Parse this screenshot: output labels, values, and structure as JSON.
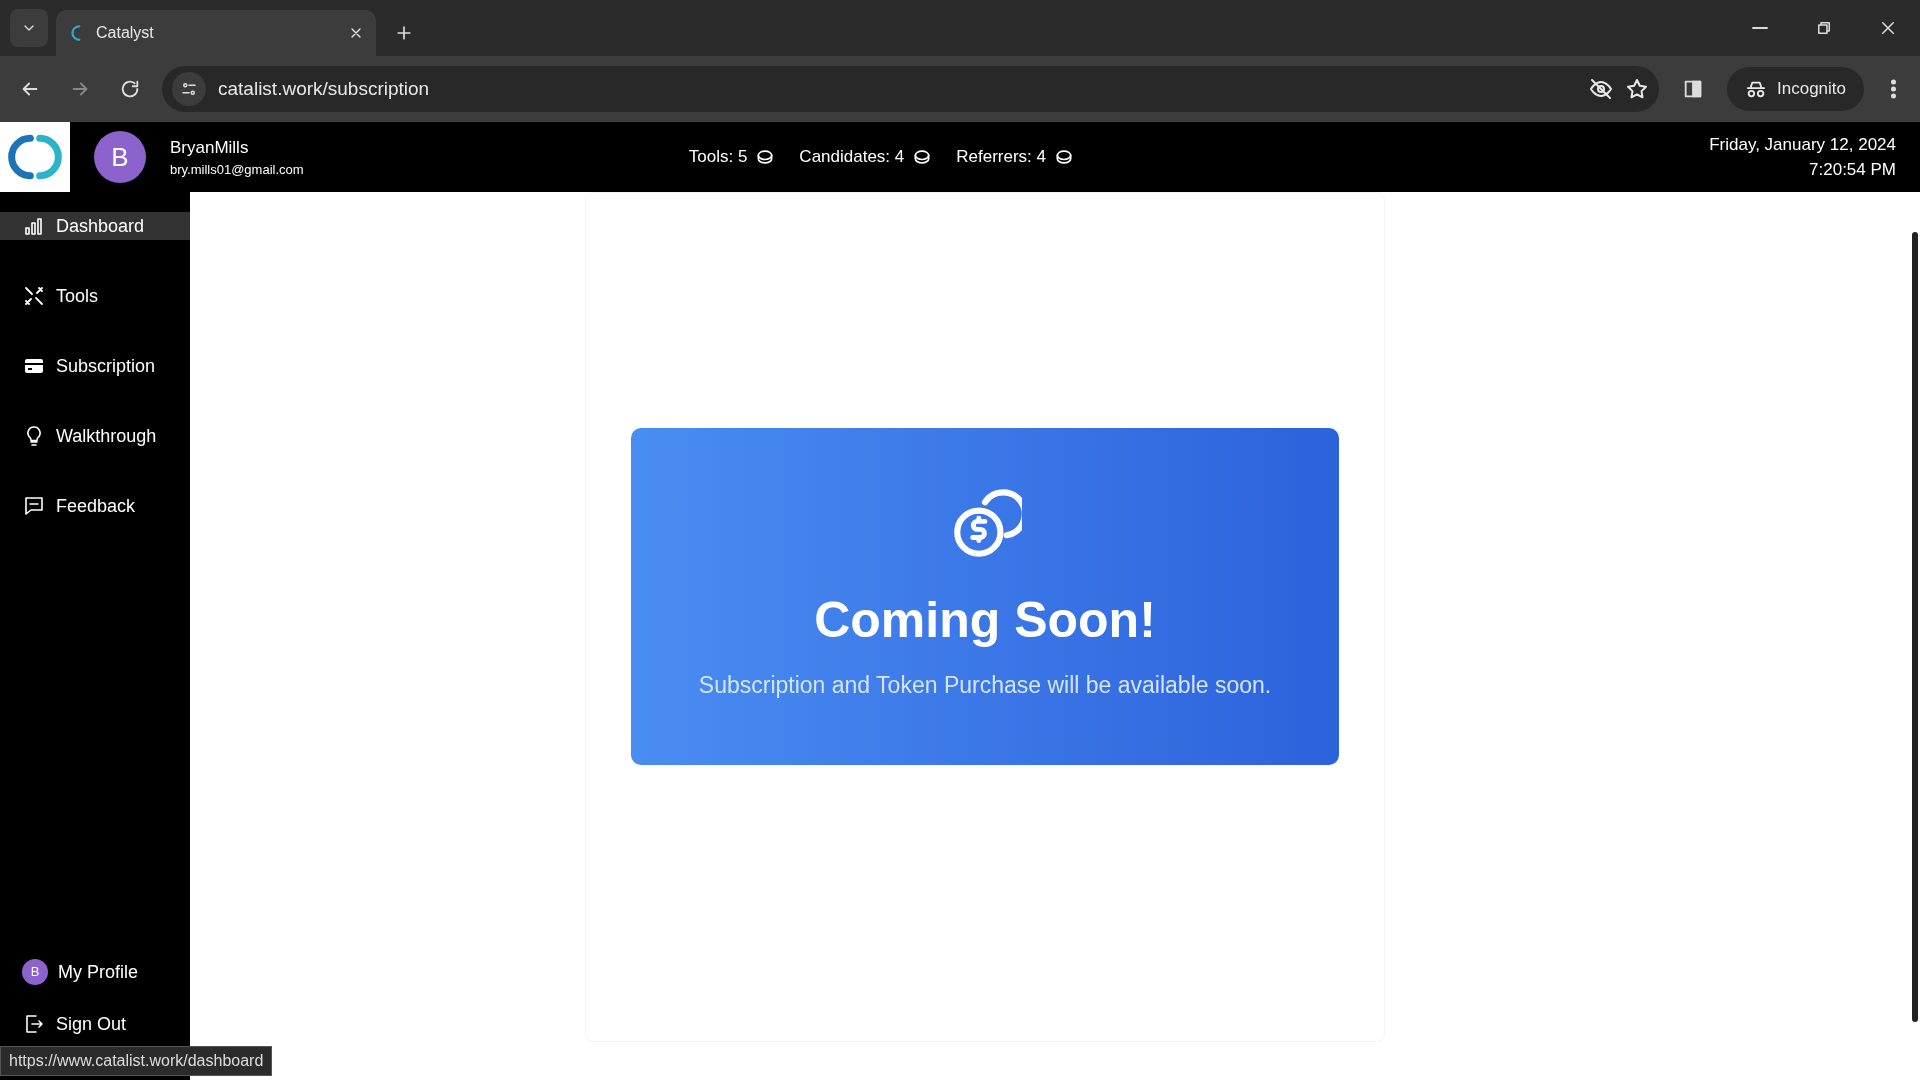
{
  "browser": {
    "tabs": [
      {
        "title": "Catalyst",
        "selected": true
      }
    ],
    "url": "catalist.work/subscription",
    "profile_label": "Incognito",
    "status_url": "https://www.catalist.work/dashboard"
  },
  "header": {
    "user": {
      "initial": "B",
      "name": "BryanMills",
      "email": "bry.mills01@gmail.com"
    },
    "counters": [
      {
        "label": "Tools: 5"
      },
      {
        "label": "Candidates: 4"
      },
      {
        "label": "Referrers: 4"
      }
    ],
    "date": "Friday, January 12, 2024",
    "time": "7:20:54 PM"
  },
  "sidebar": {
    "items": [
      {
        "label": "Dashboard",
        "selected": true
      },
      {
        "label": "Tools",
        "selected": false
      },
      {
        "label": "Subscription",
        "selected": false
      },
      {
        "label": "Walkthrough",
        "selected": false
      },
      {
        "label": "Feedback",
        "selected": false
      }
    ],
    "profile": {
      "initial": "B",
      "label": "My Profile"
    },
    "sign_out": "Sign Out"
  },
  "notice": {
    "title": "Coming Soon!",
    "message": "Subscription and Token Purchase will be available soon."
  }
}
